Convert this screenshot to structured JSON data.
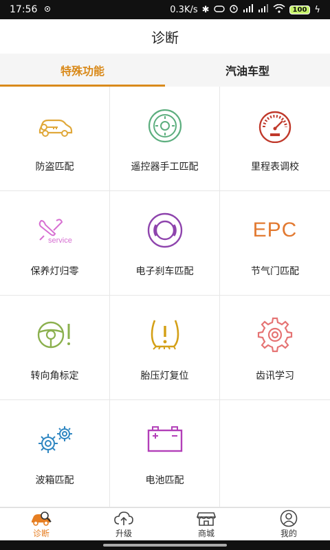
{
  "status": {
    "time": "17:56",
    "speed": "0.3K/s",
    "battery": "100"
  },
  "header": {
    "title": "诊断"
  },
  "tabs": [
    {
      "label": "特殊功能",
      "active": true
    },
    {
      "label": "汽油车型",
      "active": false
    }
  ],
  "functions": [
    {
      "label": "防盗匹配",
      "icon": "car-key-icon",
      "color": "#e0a83a"
    },
    {
      "label": "遥控器手工匹配",
      "icon": "remote-control-icon",
      "color": "#5cae7e"
    },
    {
      "label": "里程表调校",
      "icon": "odometer-icon",
      "color": "#c0392b"
    },
    {
      "label": "保养灯归零",
      "icon": "service-wrench-icon",
      "color": "#d76fd2",
      "icon_text": "service"
    },
    {
      "label": "电子刹车匹配",
      "icon": "brake-icon",
      "color": "#8e44ad"
    },
    {
      "label": "节气门匹配",
      "icon": "epc-icon",
      "color": "#e27a32",
      "icon_text": "EPC"
    },
    {
      "label": "转向角标定",
      "icon": "steering-wheel-warning-icon",
      "color": "#8bb04e"
    },
    {
      "label": "胎压灯复位",
      "icon": "tire-pressure-icon",
      "color": "#d4a017"
    },
    {
      "label": "齿讯学习",
      "icon": "gear-icon",
      "color": "#e57373"
    },
    {
      "label": "波箱匹配",
      "icon": "gears-icon",
      "color": "#2e86c1"
    },
    {
      "label": "电池匹配",
      "icon": "battery-icon",
      "color": "#b23fb8"
    }
  ],
  "bottom_nav": [
    {
      "label": "诊断",
      "icon": "diagnose-icon",
      "active": true
    },
    {
      "label": "升级",
      "icon": "cloud-upgrade-icon",
      "active": false
    },
    {
      "label": "商城",
      "icon": "shop-icon",
      "active": false
    },
    {
      "label": "我的",
      "icon": "profile-icon",
      "active": false
    }
  ]
}
